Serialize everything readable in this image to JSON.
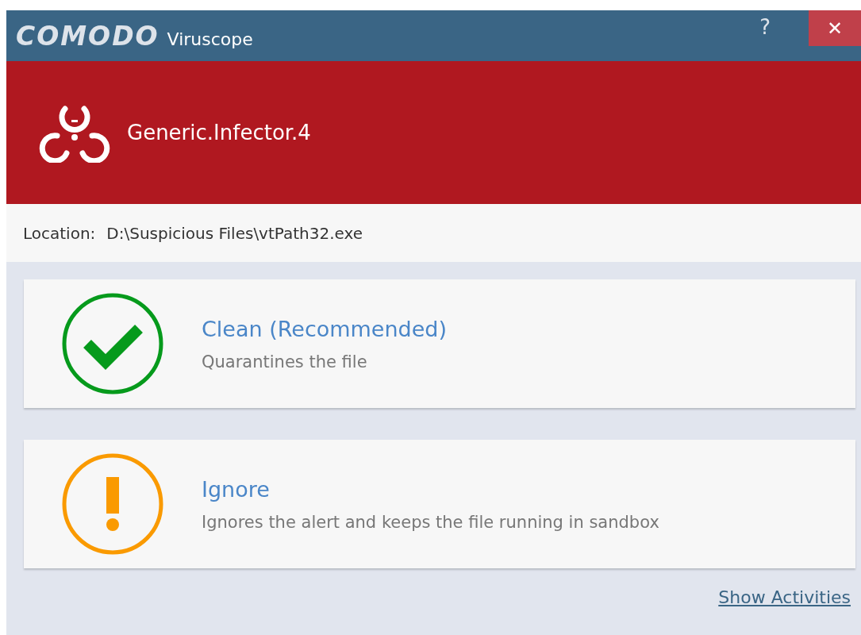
{
  "window": {
    "brand": "COMODO",
    "title": "Viruscope",
    "help": "?",
    "close": "✕"
  },
  "threat": {
    "name": "Generic.Infector.4"
  },
  "location": {
    "label": "Location:",
    "path": "D:\\Suspicious Files\\vtPath32.exe"
  },
  "actions": [
    {
      "kind": "clean",
      "title": "Clean (Recommended)",
      "description": "Quarantines the file"
    },
    {
      "kind": "ignore",
      "title": "Ignore",
      "description": "Ignores the alert and keeps the file running in sandbox"
    }
  ],
  "link": "Show Activities"
}
